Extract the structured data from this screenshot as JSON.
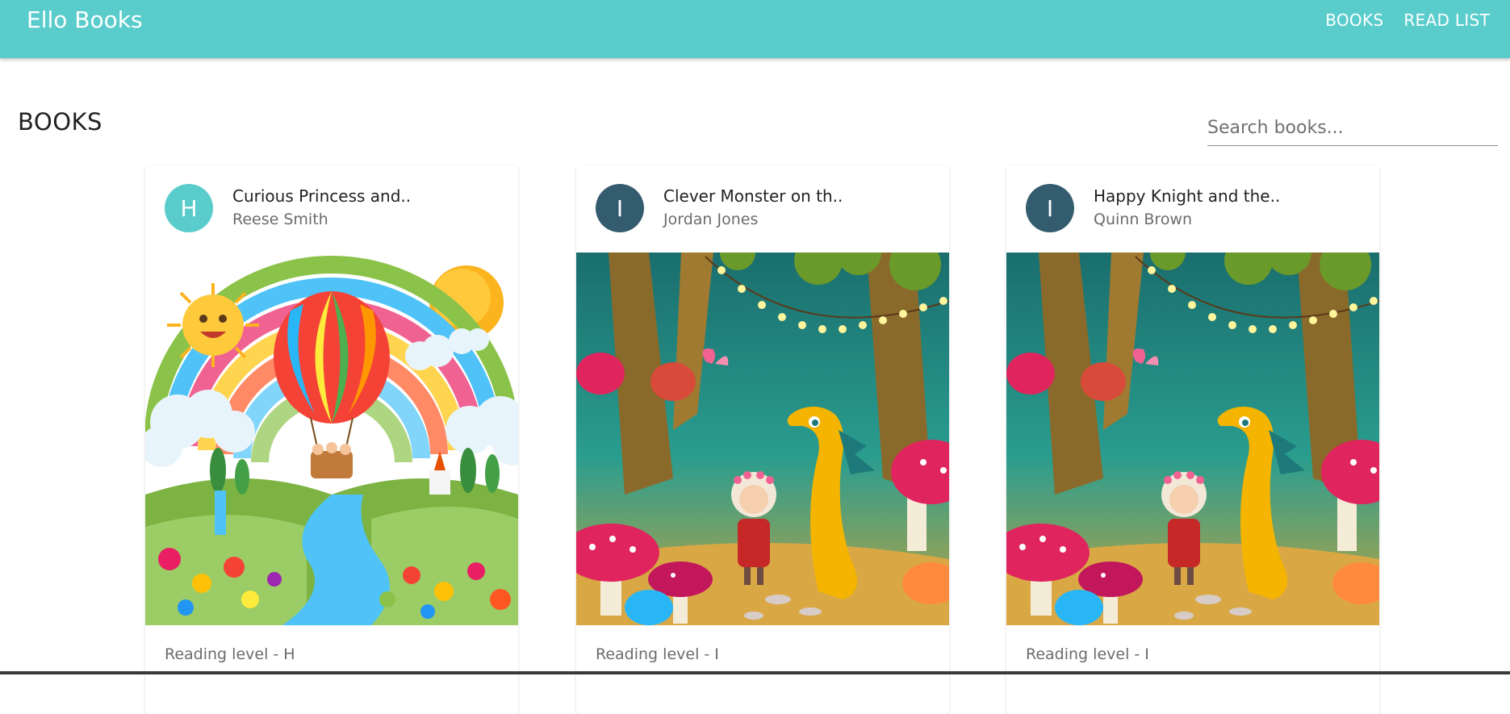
{
  "appbar": {
    "brand": "Ello Books",
    "nav": [
      "BOOKS",
      "READ LIST"
    ],
    "color": "#5ACCCC"
  },
  "page": {
    "title": "BOOKS",
    "search_placeholder": "Search books..."
  },
  "books": [
    {
      "avatar_letter": "H",
      "avatar_color": "#5ACCCC",
      "title": "Curious Princess and..",
      "author": "Reese Smith",
      "level": "Reading level - H",
      "cover": "rainbow-balloon-illustration"
    },
    {
      "avatar_letter": "I",
      "avatar_color": "#335C6E",
      "title": "Clever Monster on th..",
      "author": "Jordan Jones",
      "level": "Reading level - I",
      "cover": "forest-dragon-illustration"
    },
    {
      "avatar_letter": "I",
      "avatar_color": "#335C6E",
      "title": "Happy Knight and the..",
      "author": "Quinn Brown",
      "level": "Reading level - I",
      "cover": "forest-dragon-illustration"
    }
  ]
}
